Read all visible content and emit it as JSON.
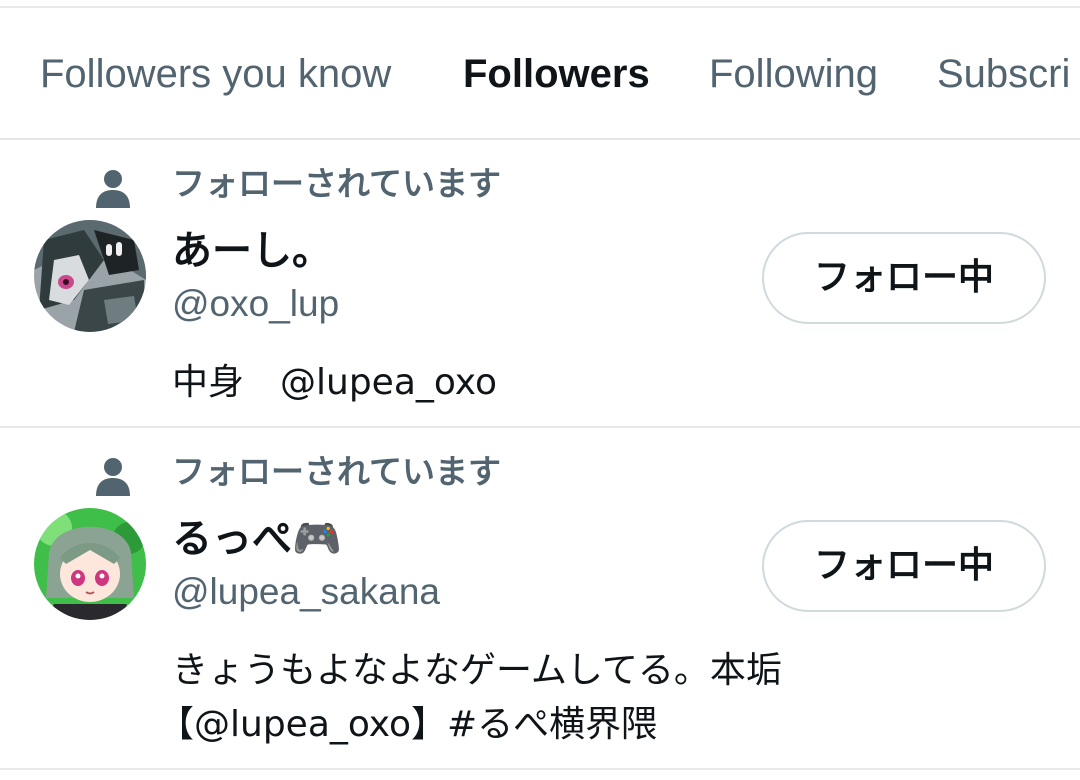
{
  "tabs": [
    {
      "label": "Followers you know",
      "active": false
    },
    {
      "label": "Followers",
      "active": true
    },
    {
      "label": "Following",
      "active": false
    },
    {
      "label": "Subscri",
      "active": false
    }
  ],
  "accent_color": "#1d9bf0",
  "users": [
    {
      "context": "フォローされています",
      "name": "あーし。",
      "handle": "@oxo_lup",
      "bio_lines": [
        "中身　@lupea_oxo"
      ],
      "button_label": "フォロー中",
      "avatar_icon": "anime-avatar-dark-icon"
    },
    {
      "context": "フォローされています",
      "name": "るっぺ🎮",
      "handle": "@lupea_sakana",
      "bio_lines": [
        "きょうもよなよなゲームしてる。本垢",
        "【@lupea_oxo】#るぺ横界隈"
      ],
      "button_label": "フォロー中",
      "avatar_icon": "anime-avatar-green-icon"
    }
  ]
}
